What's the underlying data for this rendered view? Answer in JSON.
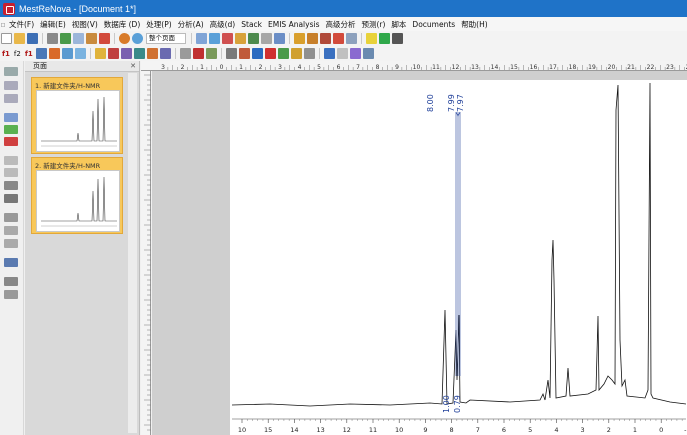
{
  "window": {
    "title": "MestReNova - [Document 1*]"
  },
  "menu": [
    "文件(F)",
    "编辑(E)",
    "视图(V)",
    "数据库 (D)",
    "处理(P)",
    "分析(A)",
    "高级(d)",
    "Stack",
    "EMIS Analysis",
    "高级分析",
    "预测(r)",
    "脚本",
    "Documents",
    "帮助(H)"
  ],
  "toolbar": {
    "zoom_label": "整个页面",
    "f1_label": "f1",
    "f2_label": "f2",
    "f1_alt_label": "f1"
  },
  "panel": {
    "title": "页面",
    "pages": [
      {
        "label": "1. 新建文件夹/H-NMR"
      },
      {
        "label": "2. 新建文件夹/H-NMR"
      }
    ]
  },
  "ruler": {
    "labels": [
      "3",
      "2",
      "1",
      "0",
      "1",
      "2",
      "3",
      "4",
      "5",
      "6",
      "7",
      "8",
      "9",
      "10",
      "11",
      "12",
      "13",
      "14",
      "15",
      "16",
      "17",
      "18",
      "19",
      "20",
      "21",
      "22",
      "23",
      "24"
    ]
  },
  "spectrum": {
    "peak_labels_top": [
      "8.00",
      "7.99",
      "7.97"
    ],
    "integrals": [
      "1.00",
      "0.79"
    ],
    "axis_labels": [
      "10",
      "15",
      "14",
      "13",
      "12",
      "11",
      "10",
      "9",
      "8",
      "7",
      "6",
      "5",
      "4",
      "3",
      "2",
      "1",
      "0",
      "-1"
    ]
  },
  "colors": {
    "titlebar": "#1f73c8",
    "peak_label": "#1f3f99",
    "highlight": "#f8c85a"
  }
}
